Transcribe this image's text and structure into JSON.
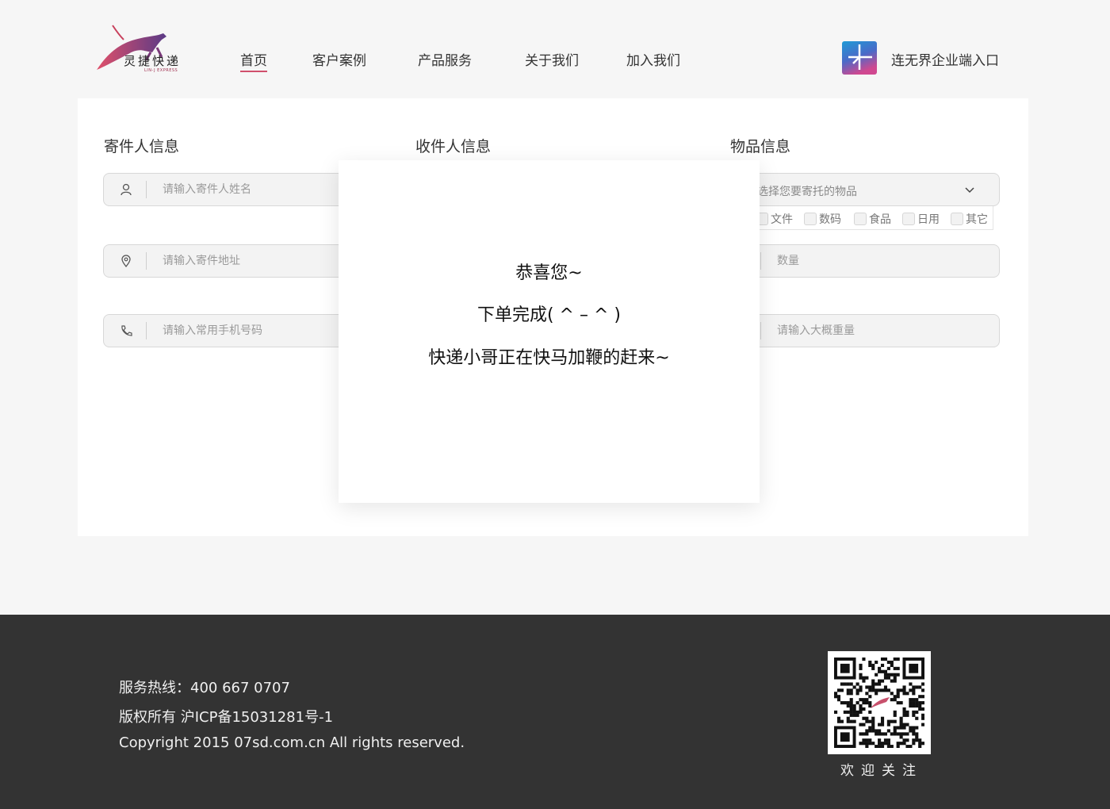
{
  "header": {
    "logo_text": "灵捷快递",
    "logo_sub": "LIN-J EXPRESS",
    "nav": [
      "首页",
      "客户案例",
      "产品服务",
      "关于我们",
      "加入我们"
    ],
    "active_nav": 0,
    "enterprise_link": "连无界企业端入口"
  },
  "sender": {
    "title": "寄件人信息",
    "name_placeholder": "请输入寄件人姓名",
    "address_placeholder": "请输入寄件地址",
    "phone_placeholder": "请输入常用手机号码"
  },
  "receiver": {
    "title": "收件人信息"
  },
  "item": {
    "title": "物品信息",
    "select_placeholder": "选择您要寄托的物品",
    "categories": [
      "文件",
      "数码",
      "食品",
      "日用",
      "其它"
    ],
    "quantity_placeholder": "数量",
    "weight_placeholder": "请输入大概重量"
  },
  "modal": {
    "line1": "恭喜您~",
    "line2": "下单完成( ^ – ^ )",
    "line3": "快递小哥正在快马加鞭的赶来~"
  },
  "footer": {
    "hotline": "服务热线：400 667 0707",
    "icp": "版权所有    沪ICP备15031281号-1",
    "copyright": "Copyright  2015 07sd.com.cn All rights reserved.",
    "qr_caption": "欢迎关注"
  },
  "colors": {
    "accent": "#d0506c",
    "footer_bg": "#333333",
    "page_bg": "#f6f6f6"
  }
}
